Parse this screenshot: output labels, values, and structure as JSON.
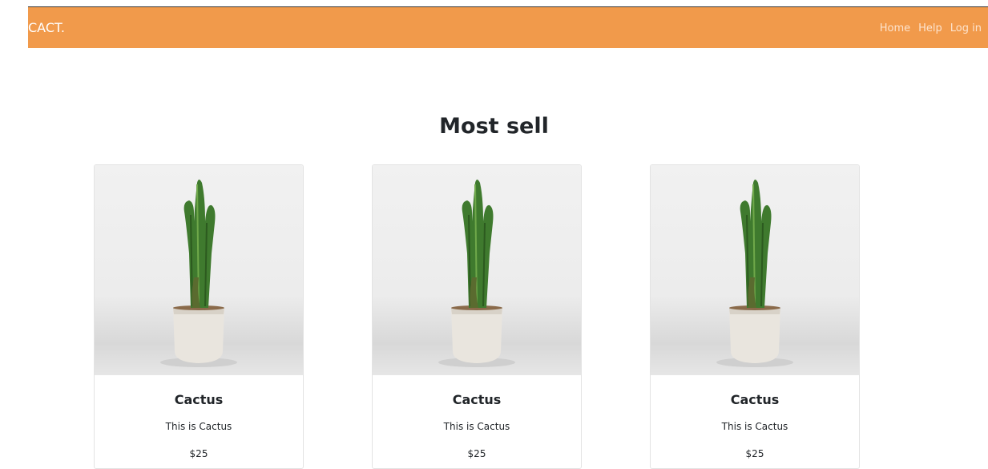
{
  "navbar": {
    "brand": "CACT.",
    "links": [
      {
        "label": "Home"
      },
      {
        "label": "Help"
      },
      {
        "label": "Log in"
      }
    ],
    "background_color": "#f19a4b"
  },
  "section": {
    "title": "Most sell"
  },
  "products": [
    {
      "name": "Cactus",
      "description": "This is Cactus",
      "price": "$25",
      "image": "cactus-pot-image"
    },
    {
      "name": "Cactus",
      "description": "This is Cactus",
      "price": "$25",
      "image": "cactus-pot-image"
    },
    {
      "name": "Cactus",
      "description": "This is Cactus",
      "price": "$25",
      "image": "cactus-pot-image"
    }
  ]
}
